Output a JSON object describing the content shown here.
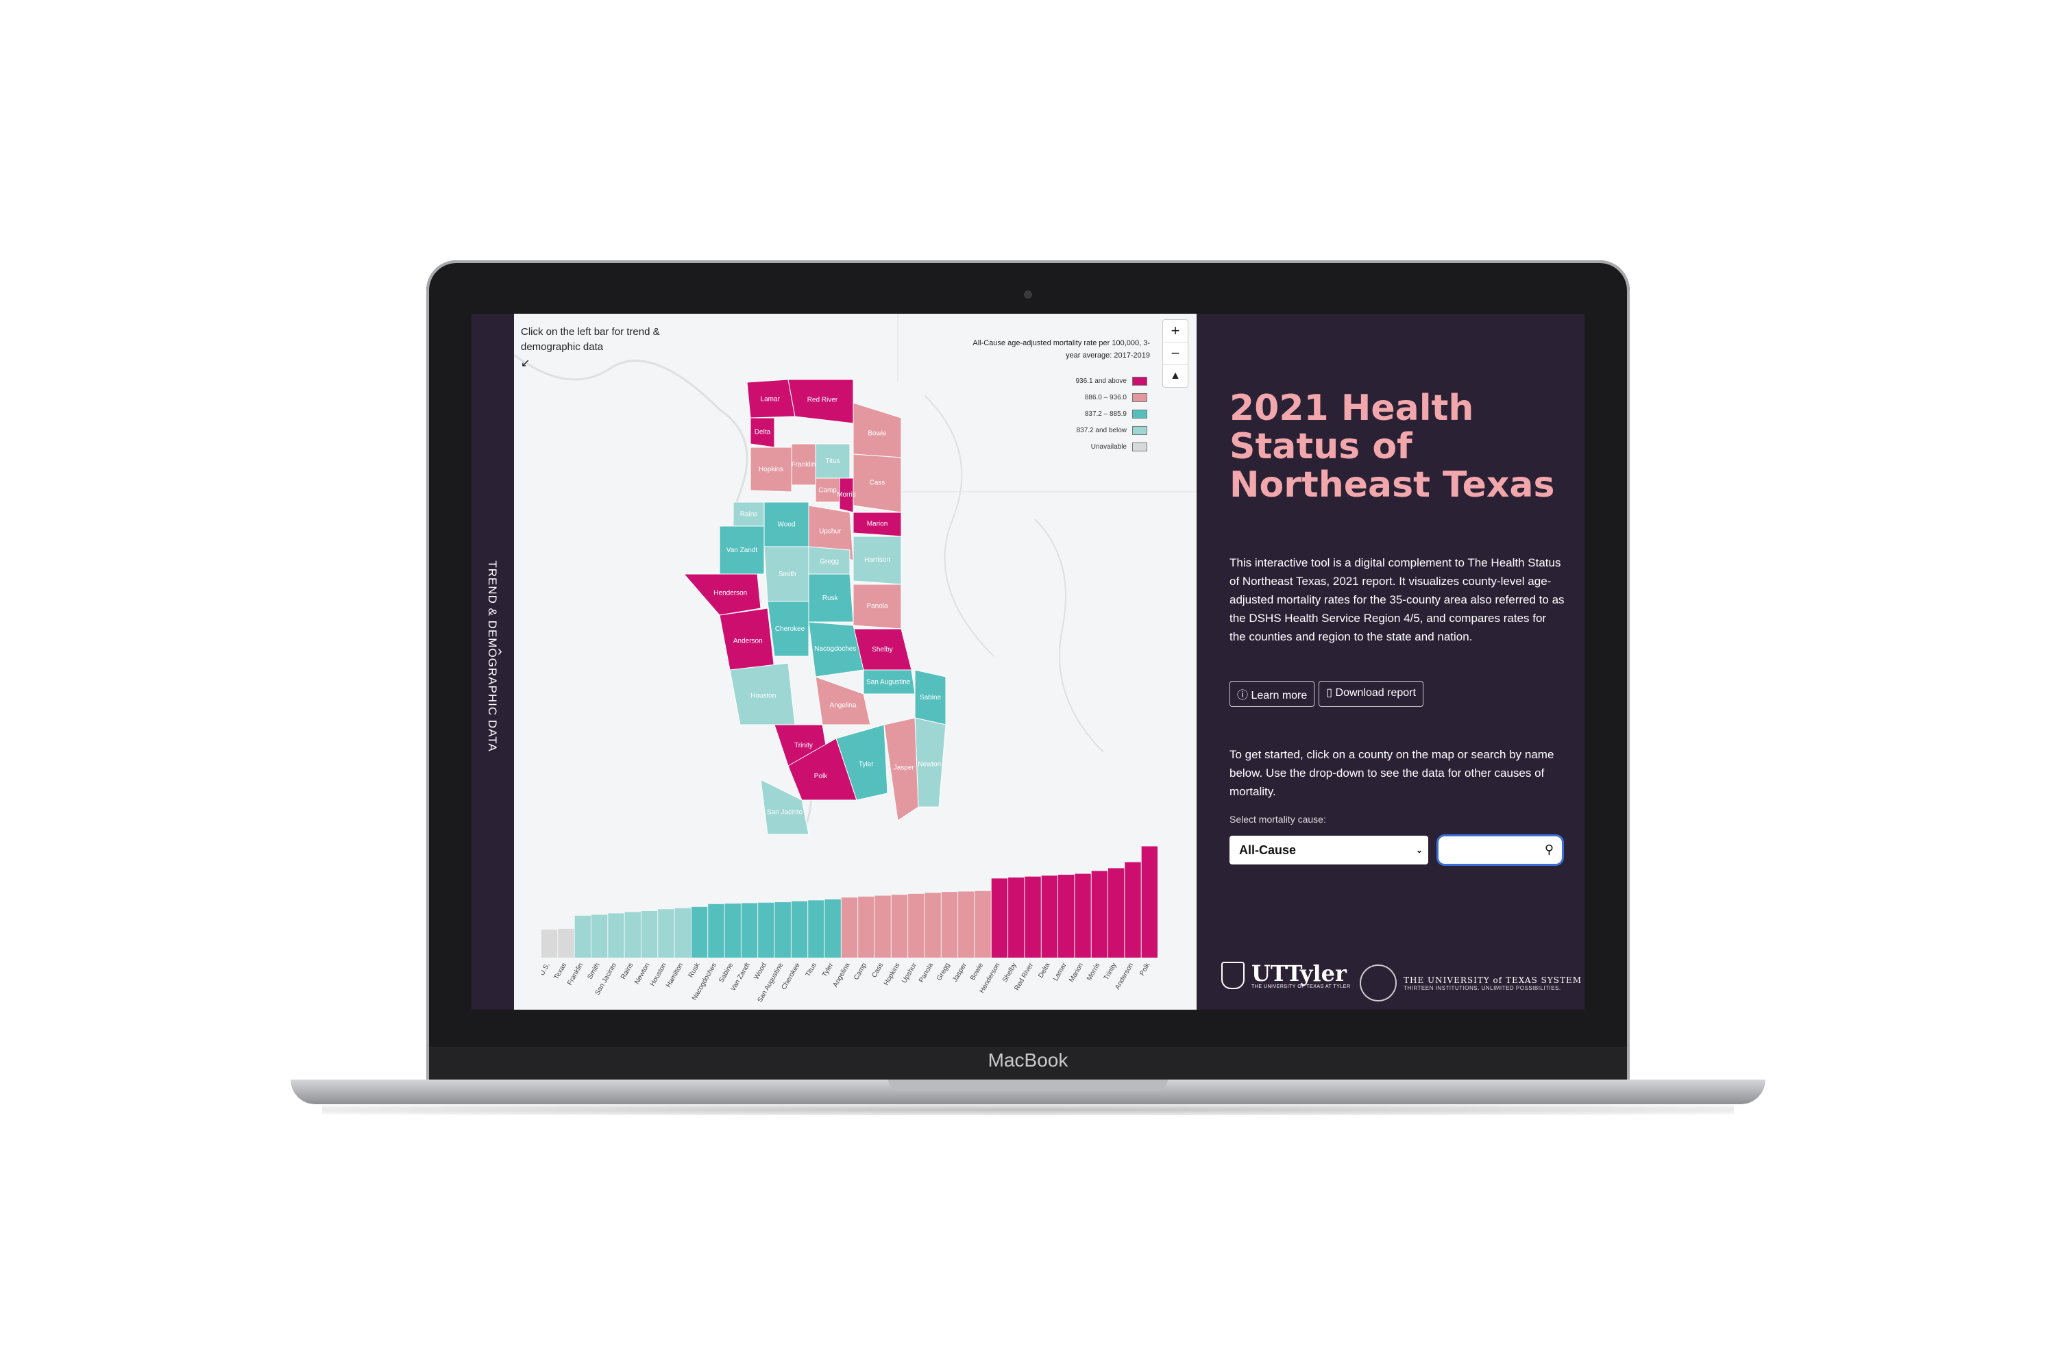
{
  "device_label": "MacBook",
  "sidebar": {
    "label": "TREND & DEMOGRAPHIC DATA",
    "chevron": "chevron-right-icon"
  },
  "map": {
    "hint": "Click on the left bar for trend & demographic data",
    "legend_title": "All-Cause age-adjusted mortality rate per 100,000, 3-year average: 2017-2019",
    "legend": [
      {
        "label": "936.1 and above",
        "color": "#cc0f6f"
      },
      {
        "label": "886.0 – 936.0",
        "color": "#e3989f"
      },
      {
        "label": "837.2 – 885.9",
        "color": "#55bfbe"
      },
      {
        "label": "837.2 and below",
        "color": "#9ed6d4"
      },
      {
        "label": "Unavailable",
        "color": "#d9d9d9"
      }
    ],
    "zoom_in": "+",
    "zoom_out": "−",
    "reset": "▲",
    "counties": [
      "Lamar",
      "Red River",
      "Bowie",
      "Delta",
      "Hopkins",
      "Franklin",
      "Titus",
      "Cass",
      "Camp",
      "Morris",
      "Rains",
      "Wood",
      "Upshur",
      "Marion",
      "Van Zandt",
      "Gregg",
      "Harrison",
      "Smith",
      "Rusk",
      "Panola",
      "Henderson",
      "Cherokee",
      "Anderson",
      "Shelby",
      "Nacogdoches",
      "San Augustine",
      "Houston",
      "Sabine",
      "Angelina",
      "Trinity",
      "Newton",
      "Jasper",
      "Polk",
      "Tyler",
      "San Jacinto"
    ]
  },
  "chart_data": {
    "type": "bar",
    "categories": [
      "U.S.",
      "Texas",
      "Franklin",
      "Smith",
      "San Jacinto",
      "Rains",
      "Newton",
      "Houston",
      "Hamilton",
      "Rusk",
      "Nacogdoches",
      "Sabine",
      "Van Zandt",
      "Wood",
      "San Augustine",
      "Cherokee",
      "Titus",
      "Tyler",
      "Angelina",
      "Camp",
      "Cass",
      "Hopkins",
      "Upshur",
      "Panola",
      "Gregg",
      "Jasper",
      "Bowie",
      "Henderson",
      "Shelby",
      "Red River",
      "Delta",
      "Lamar",
      "Marion",
      "Morris",
      "Trinity",
      "Anderson",
      "Polk"
    ],
    "values": [
      720,
      724,
      780,
      784,
      790,
      796,
      800,
      808,
      812,
      818,
      830,
      832,
      834,
      836,
      838,
      842,
      846,
      850,
      858,
      862,
      866,
      870,
      874,
      878,
      882,
      884,
      886,
      940,
      944,
      948,
      952,
      956,
      960,
      972,
      984,
      1010,
      1078
    ],
    "colors": [
      "#d9d9d9",
      "#d9d9d9",
      "#9ed6d4",
      "#9ed6d4",
      "#9ed6d4",
      "#9ed6d4",
      "#9ed6d4",
      "#9ed6d4",
      "#9ed6d4",
      "#55bfbe",
      "#55bfbe",
      "#55bfbe",
      "#55bfbe",
      "#55bfbe",
      "#55bfbe",
      "#55bfbe",
      "#55bfbe",
      "#55bfbe",
      "#e3989f",
      "#e3989f",
      "#e3989f",
      "#e3989f",
      "#e3989f",
      "#e3989f",
      "#e3989f",
      "#e3989f",
      "#e3989f",
      "#cc0f6f",
      "#cc0f6f",
      "#cc0f6f",
      "#cc0f6f",
      "#cc0f6f",
      "#cc0f6f",
      "#cc0f6f",
      "#cc0f6f",
      "#cc0f6f",
      "#cc0f6f"
    ],
    "ylim": [
      0,
      1100
    ]
  },
  "panel": {
    "title": "2021 Health Status of Northeast Texas",
    "description": "This interactive tool is a digital complement to The Health Status of Northeast Texas, 2021 report. It visualizes county-level age-adjusted mortality rates for the 35-county area also referred to as the DSHS Health Service Region 4/5, and compares rates for the counties and region to the state and nation.",
    "learn_more": "Learn more",
    "download": "Download report",
    "intro": "To get started, click on a county on the map or search by name below. Use the drop-down to see the data for other causes of mortality.",
    "select_label": "Select mortality cause:",
    "select_value": "All-Cause",
    "search_placeholder": "",
    "logo1_name": "UTTyler",
    "logo1_sub": "THE UNIVERSITY OF TEXAS AT TYLER",
    "logo2_name": "THE UNIVERSITY of TEXAS SYSTEM",
    "logo2_sub": "THIRTEEN INSTITUTIONS. UNLIMITED POSSIBILITIES."
  }
}
